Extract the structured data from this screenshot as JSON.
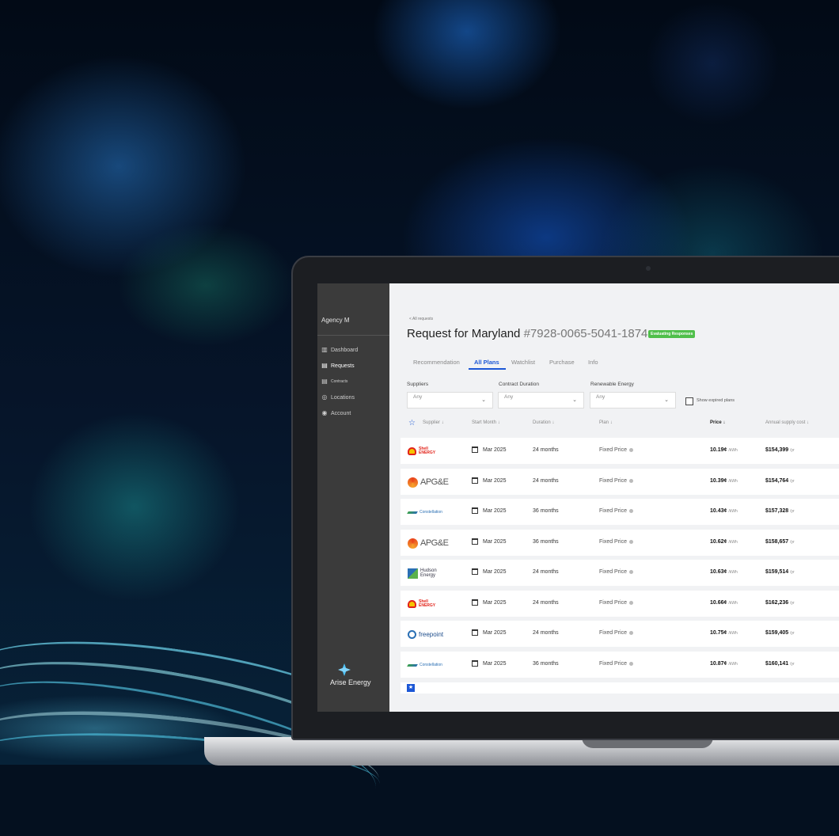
{
  "app": {
    "agency": "Agency M",
    "brand": "Arise Energy"
  },
  "sidebar": {
    "items": [
      {
        "label": "Dashboard",
        "icon": "dashboard-icon",
        "active": false
      },
      {
        "label": "Requests",
        "icon": "requests-icon",
        "active": true
      },
      {
        "label": "Contracts",
        "icon": "contracts-icon",
        "active": false
      },
      {
        "label": "Locations",
        "icon": "location-icon",
        "active": false
      },
      {
        "label": "Account",
        "icon": "account-icon",
        "active": false
      }
    ]
  },
  "header": {
    "breadcrumb": "< All requests",
    "title": "Request for Maryland",
    "request_number": "#7928-0065-5041-1874",
    "status_badge": "Evaluating Responses"
  },
  "tabs": [
    {
      "label": "Recommendation",
      "active": false
    },
    {
      "label": "All Plans",
      "active": true
    },
    {
      "label": "Watchlist",
      "active": false
    },
    {
      "label": "Purchase",
      "active": false
    },
    {
      "label": "Info",
      "active": false
    }
  ],
  "filters": {
    "suppliers": {
      "label": "Suppliers",
      "value": "Any"
    },
    "contract_duration": {
      "label": "Contract Duration",
      "value": "Any"
    },
    "renewable_energy": {
      "label": "Renewable Energy",
      "value": "Any"
    },
    "show_expired": {
      "label": "Show expired plans",
      "checked": false
    }
  },
  "table": {
    "columns": {
      "supplier": "Supplier",
      "start_month": "Start Month",
      "duration": "Duration",
      "plan": "Plan",
      "price": "Price",
      "annual_cost": "Annual supply cost"
    },
    "rows": [
      {
        "supplier": "Shell Energy",
        "logo_line1": "Shell",
        "logo_line2": "ENERGY",
        "start": "Mar 2025",
        "duration": "24 months",
        "plan": "Fixed Price",
        "price": "10.19¢",
        "price_unit": "/kWh",
        "annual": "$154,399",
        "annual_unit": "/yr"
      },
      {
        "supplier": "APG&E",
        "logo_line1": "APG&E",
        "start": "Mar 2025",
        "duration": "24 months",
        "plan": "Fixed Price",
        "price": "10.39¢",
        "price_unit": "/kWh",
        "annual": "$154,764",
        "annual_unit": "/yr"
      },
      {
        "supplier": "Constellation",
        "logo_line1": "Constellation",
        "start": "Mar 2025",
        "duration": "36 months",
        "plan": "Fixed Price",
        "price": "10.43¢",
        "price_unit": "/kWh",
        "annual": "$157,328",
        "annual_unit": "/yr"
      },
      {
        "supplier": "APG&E",
        "logo_line1": "APG&E",
        "start": "Mar 2025",
        "duration": "36 months",
        "plan": "Fixed Price",
        "price": "10.62¢",
        "price_unit": "/kWh",
        "annual": "$158,657",
        "annual_unit": "/yr"
      },
      {
        "supplier": "Hudson Energy",
        "logo_line1": "Hudson",
        "logo_line2": "Energy",
        "start": "Mar 2025",
        "duration": "24 months",
        "plan": "Fixed Price",
        "price": "10.63¢",
        "price_unit": "/kWh",
        "annual": "$159,514",
        "annual_unit": "/yr"
      },
      {
        "supplier": "Shell Energy",
        "logo_line1": "Shell",
        "logo_line2": "ENERGY",
        "start": "Mar 2025",
        "duration": "24 months",
        "plan": "Fixed Price",
        "price": "10.66¢",
        "price_unit": "/kWh",
        "annual": "$162,236",
        "annual_unit": "/yr"
      },
      {
        "supplier": "freepoint",
        "logo_line1": "freepoint",
        "start": "Mar 2025",
        "duration": "24 months",
        "plan": "Fixed Price",
        "price": "10.75¢",
        "price_unit": "/kWh",
        "annual": "$159,405",
        "annual_unit": "/yr"
      },
      {
        "supplier": "Constellation",
        "logo_line1": "Constellation",
        "start": "Mar 2025",
        "duration": "36 months",
        "plan": "Fixed Price",
        "price": "10.87¢",
        "price_unit": "/kWh",
        "annual": "$160,141",
        "annual_unit": "/yr"
      }
    ]
  },
  "colors": {
    "accent": "#1c57d6",
    "badge": "#4fbf4a",
    "sidebar": "#3b3b3b"
  }
}
